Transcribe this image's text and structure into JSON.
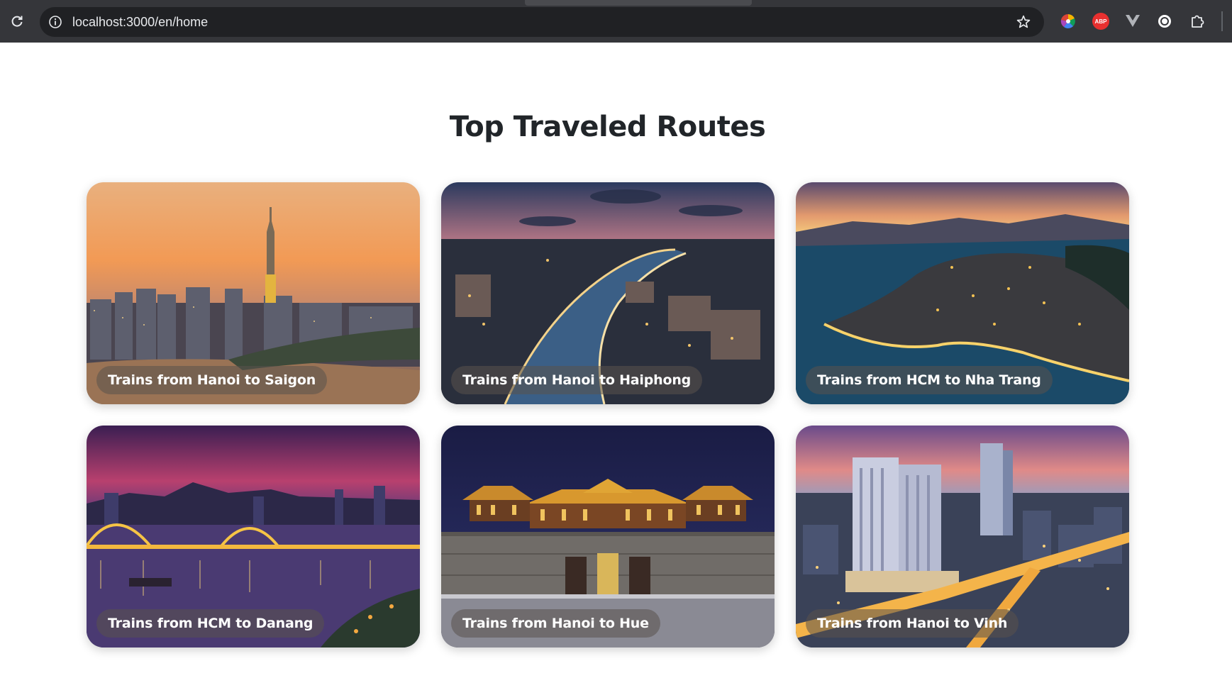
{
  "browser": {
    "url": "localhost:3000/en/home",
    "extensions": {
      "abp_label": "ABP"
    }
  },
  "page": {
    "title": "Top Traveled Routes"
  },
  "routes": [
    {
      "label": "Trains from Hanoi to Saigon",
      "scene": "city-sunset-tower"
    },
    {
      "label": "Trains from Hanoi to Haiphong",
      "scene": "river-city-dusk"
    },
    {
      "label": "Trains from HCM to Nha Trang",
      "scene": "coastal-city-night"
    },
    {
      "label": "Trains from HCM to Danang",
      "scene": "dragon-bridge-night"
    },
    {
      "label": "Trains from Hanoi to Hue",
      "scene": "imperial-gate-night"
    },
    {
      "label": "Trains from Hanoi to Vinh",
      "scene": "city-towers-evening"
    }
  ]
}
